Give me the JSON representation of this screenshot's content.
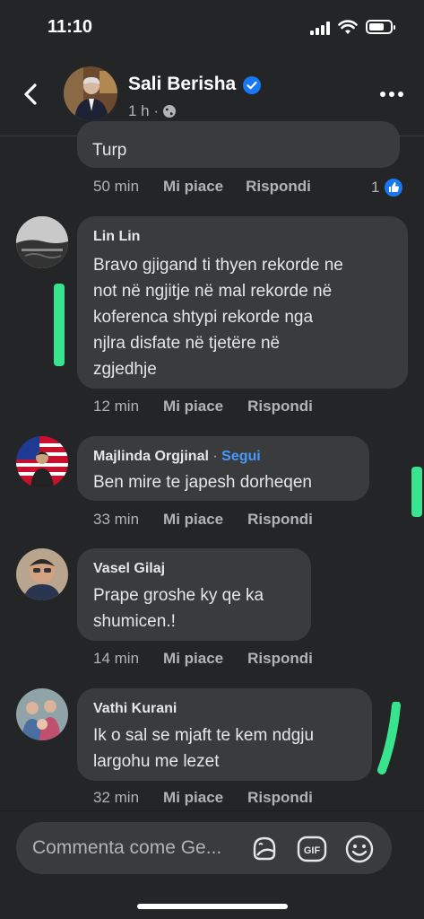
{
  "status": {
    "time": "11:10"
  },
  "header": {
    "name": "Sali Berisha",
    "meta": "1 h ·"
  },
  "comments": [
    {
      "name": "",
      "text": "Turp",
      "time": "50 min",
      "like": "Mi piace",
      "reply": "Rispondi",
      "likes": "1"
    },
    {
      "name": "Lin Lin",
      "text_lines": [
        "Bravo gjigand ti thyen rekorde ne",
        "not në ngjitje në mal rekorde në",
        "koferenca shtypi  rekorde nga",
        "njlra disfate në tjetëre në",
        "zgjedhje"
      ],
      "time": "12 min",
      "like": "Mi piace",
      "reply": "Rispondi"
    },
    {
      "name": "Majlinda Orgjinal",
      "follow": "Segui",
      "text": "Ben mire te japesh dorheqen",
      "time": "33 min",
      "like": "Mi piace",
      "reply": "Rispondi"
    },
    {
      "name": "Vasel Gilaj",
      "text_lines": [
        "Prape groshe ky qe ka",
        "shumicen.!"
      ],
      "time": "14 min",
      "like": "Mi piace",
      "reply": "Rispondi"
    },
    {
      "name": "Vathi Kurani",
      "text_lines": [
        "Ik o sal se mjaft te kem ndgju",
        "largohu me lezet"
      ],
      "time": "32 min",
      "like": "Mi piace",
      "reply": "Rispondi"
    }
  ],
  "composer": {
    "placeholder": "Commenta come Ge..."
  },
  "colors": {
    "background": "#242526",
    "bubble": "#3a3b3c",
    "accent": "#4599ff",
    "highlight": "#39e48f"
  }
}
